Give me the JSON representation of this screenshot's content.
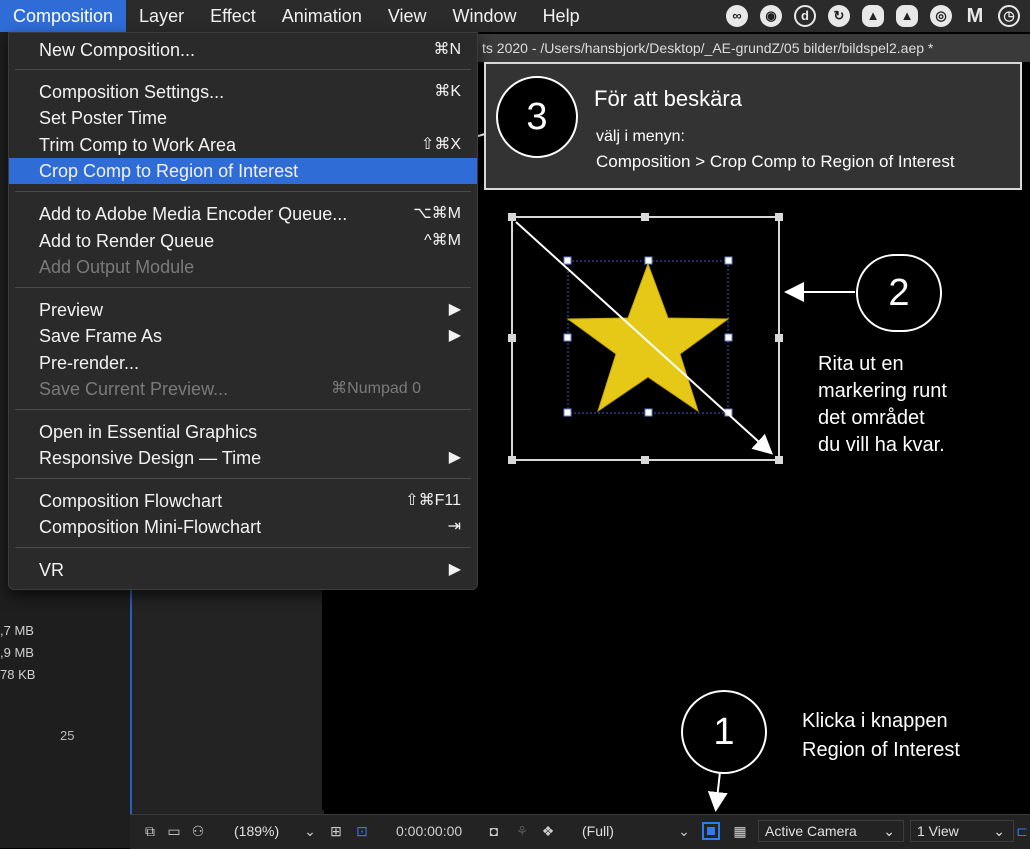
{
  "menubar": {
    "items": [
      "Composition",
      "Layer",
      "Effect",
      "Animation",
      "View",
      "Window",
      "Help"
    ],
    "active": "Composition",
    "system_icons": [
      "creative-cloud-icon",
      "alfred-icon",
      "dash-icon",
      "flow-icon",
      "upload-cloud-icon",
      "dropbox-icon",
      "grammar-icon",
      "m-icon",
      "time-machine-icon"
    ]
  },
  "window_title": "ts 2020 - /Users/hansbjork/Desktop/_AE-grundZ/05 bilder/bildspel2.aep *",
  "menu": {
    "items": [
      {
        "label": "New Composition...",
        "shortcut": "⌘N"
      },
      {
        "label": "Composition Settings...",
        "shortcut": "⌘K"
      },
      {
        "label": "Set Poster Time",
        "shortcut": ""
      },
      {
        "label": "Trim Comp to Work Area",
        "shortcut": "⇧⌘X"
      },
      {
        "label": "Crop Comp to Region of Interest",
        "shortcut": ""
      },
      {
        "label": "Add to Adobe Media Encoder Queue...",
        "shortcut": "⌥⌘M"
      },
      {
        "label": "Add to Render Queue",
        "shortcut": "^⌘M"
      },
      {
        "label": "Add Output Module",
        "shortcut": ""
      },
      {
        "label": "Preview",
        "shortcut": "▶"
      },
      {
        "label": "Save Frame As",
        "shortcut": "▶"
      },
      {
        "label": "Pre-render...",
        "shortcut": ""
      },
      {
        "label": "Save Current Preview...",
        "shortcut": "⌘Numpad 0"
      },
      {
        "label": "Open in Essential Graphics",
        "shortcut": ""
      },
      {
        "label": "Responsive Design — Time",
        "shortcut": "▶"
      },
      {
        "label": "Composition Flowchart",
        "shortcut": "⇧⌘F11"
      },
      {
        "label": "Composition Mini-Flowchart",
        "shortcut": "⇥"
      },
      {
        "label": "VR",
        "shortcut": "▶"
      }
    ],
    "highlighted": "Crop Comp to Region of Interest",
    "disabled": [
      "Add Output Module",
      "Save Current Preview..."
    ]
  },
  "left_panel": {
    "sizes": [
      ",7 MB",
      ",9 MB",
      "78 KB"
    ],
    "number": "25"
  },
  "callout3": {
    "number": "3",
    "title": "För att beskära",
    "line1": "välj i menyn:",
    "line2": "Composition > Crop Comp to Region of Interest"
  },
  "callout2": {
    "number": "2",
    "text": [
      "Rita ut en",
      "markering runt",
      "det området",
      "du vill ha kvar."
    ]
  },
  "callout1": {
    "number": "1",
    "text": [
      "Klicka i knappen",
      "Region of Interest"
    ]
  },
  "bottom_bar": {
    "zoom": "(189%)",
    "timecode": "0:00:00:00",
    "resolution": "(Full)",
    "camera": "Active Camera",
    "views": "1 View"
  },
  "colors": {
    "accent": "#2f6cd6",
    "star": "#e6c817",
    "roi_blue": "#2f7cf0"
  }
}
